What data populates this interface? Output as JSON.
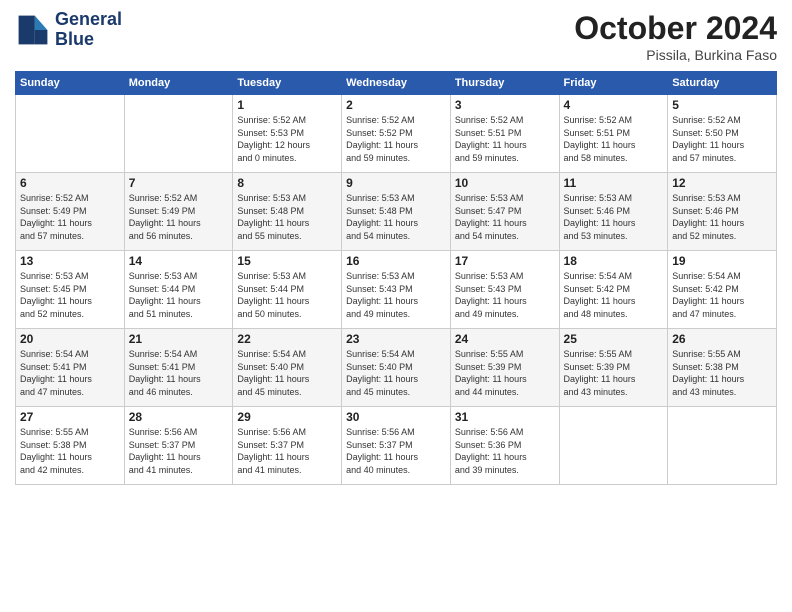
{
  "header": {
    "logo_line1": "General",
    "logo_line2": "Blue",
    "month": "October 2024",
    "location": "Pissila, Burkina Faso"
  },
  "days_of_week": [
    "Sunday",
    "Monday",
    "Tuesday",
    "Wednesday",
    "Thursday",
    "Friday",
    "Saturday"
  ],
  "weeks": [
    [
      {
        "day": "",
        "info": ""
      },
      {
        "day": "",
        "info": ""
      },
      {
        "day": "1",
        "info": "Sunrise: 5:52 AM\nSunset: 5:53 PM\nDaylight: 12 hours\nand 0 minutes."
      },
      {
        "day": "2",
        "info": "Sunrise: 5:52 AM\nSunset: 5:52 PM\nDaylight: 11 hours\nand 59 minutes."
      },
      {
        "day": "3",
        "info": "Sunrise: 5:52 AM\nSunset: 5:51 PM\nDaylight: 11 hours\nand 59 minutes."
      },
      {
        "day": "4",
        "info": "Sunrise: 5:52 AM\nSunset: 5:51 PM\nDaylight: 11 hours\nand 58 minutes."
      },
      {
        "day": "5",
        "info": "Sunrise: 5:52 AM\nSunset: 5:50 PM\nDaylight: 11 hours\nand 57 minutes."
      }
    ],
    [
      {
        "day": "6",
        "info": "Sunrise: 5:52 AM\nSunset: 5:49 PM\nDaylight: 11 hours\nand 57 minutes."
      },
      {
        "day": "7",
        "info": "Sunrise: 5:52 AM\nSunset: 5:49 PM\nDaylight: 11 hours\nand 56 minutes."
      },
      {
        "day": "8",
        "info": "Sunrise: 5:53 AM\nSunset: 5:48 PM\nDaylight: 11 hours\nand 55 minutes."
      },
      {
        "day": "9",
        "info": "Sunrise: 5:53 AM\nSunset: 5:48 PM\nDaylight: 11 hours\nand 54 minutes."
      },
      {
        "day": "10",
        "info": "Sunrise: 5:53 AM\nSunset: 5:47 PM\nDaylight: 11 hours\nand 54 minutes."
      },
      {
        "day": "11",
        "info": "Sunrise: 5:53 AM\nSunset: 5:46 PM\nDaylight: 11 hours\nand 53 minutes."
      },
      {
        "day": "12",
        "info": "Sunrise: 5:53 AM\nSunset: 5:46 PM\nDaylight: 11 hours\nand 52 minutes."
      }
    ],
    [
      {
        "day": "13",
        "info": "Sunrise: 5:53 AM\nSunset: 5:45 PM\nDaylight: 11 hours\nand 52 minutes."
      },
      {
        "day": "14",
        "info": "Sunrise: 5:53 AM\nSunset: 5:44 PM\nDaylight: 11 hours\nand 51 minutes."
      },
      {
        "day": "15",
        "info": "Sunrise: 5:53 AM\nSunset: 5:44 PM\nDaylight: 11 hours\nand 50 minutes."
      },
      {
        "day": "16",
        "info": "Sunrise: 5:53 AM\nSunset: 5:43 PM\nDaylight: 11 hours\nand 49 minutes."
      },
      {
        "day": "17",
        "info": "Sunrise: 5:53 AM\nSunset: 5:43 PM\nDaylight: 11 hours\nand 49 minutes."
      },
      {
        "day": "18",
        "info": "Sunrise: 5:54 AM\nSunset: 5:42 PM\nDaylight: 11 hours\nand 48 minutes."
      },
      {
        "day": "19",
        "info": "Sunrise: 5:54 AM\nSunset: 5:42 PM\nDaylight: 11 hours\nand 47 minutes."
      }
    ],
    [
      {
        "day": "20",
        "info": "Sunrise: 5:54 AM\nSunset: 5:41 PM\nDaylight: 11 hours\nand 47 minutes."
      },
      {
        "day": "21",
        "info": "Sunrise: 5:54 AM\nSunset: 5:41 PM\nDaylight: 11 hours\nand 46 minutes."
      },
      {
        "day": "22",
        "info": "Sunrise: 5:54 AM\nSunset: 5:40 PM\nDaylight: 11 hours\nand 45 minutes."
      },
      {
        "day": "23",
        "info": "Sunrise: 5:54 AM\nSunset: 5:40 PM\nDaylight: 11 hours\nand 45 minutes."
      },
      {
        "day": "24",
        "info": "Sunrise: 5:55 AM\nSunset: 5:39 PM\nDaylight: 11 hours\nand 44 minutes."
      },
      {
        "day": "25",
        "info": "Sunrise: 5:55 AM\nSunset: 5:39 PM\nDaylight: 11 hours\nand 43 minutes."
      },
      {
        "day": "26",
        "info": "Sunrise: 5:55 AM\nSunset: 5:38 PM\nDaylight: 11 hours\nand 43 minutes."
      }
    ],
    [
      {
        "day": "27",
        "info": "Sunrise: 5:55 AM\nSunset: 5:38 PM\nDaylight: 11 hours\nand 42 minutes."
      },
      {
        "day": "28",
        "info": "Sunrise: 5:56 AM\nSunset: 5:37 PM\nDaylight: 11 hours\nand 41 minutes."
      },
      {
        "day": "29",
        "info": "Sunrise: 5:56 AM\nSunset: 5:37 PM\nDaylight: 11 hours\nand 41 minutes."
      },
      {
        "day": "30",
        "info": "Sunrise: 5:56 AM\nSunset: 5:37 PM\nDaylight: 11 hours\nand 40 minutes."
      },
      {
        "day": "31",
        "info": "Sunrise: 5:56 AM\nSunset: 5:36 PM\nDaylight: 11 hours\nand 39 minutes."
      },
      {
        "day": "",
        "info": ""
      },
      {
        "day": "",
        "info": ""
      }
    ]
  ]
}
